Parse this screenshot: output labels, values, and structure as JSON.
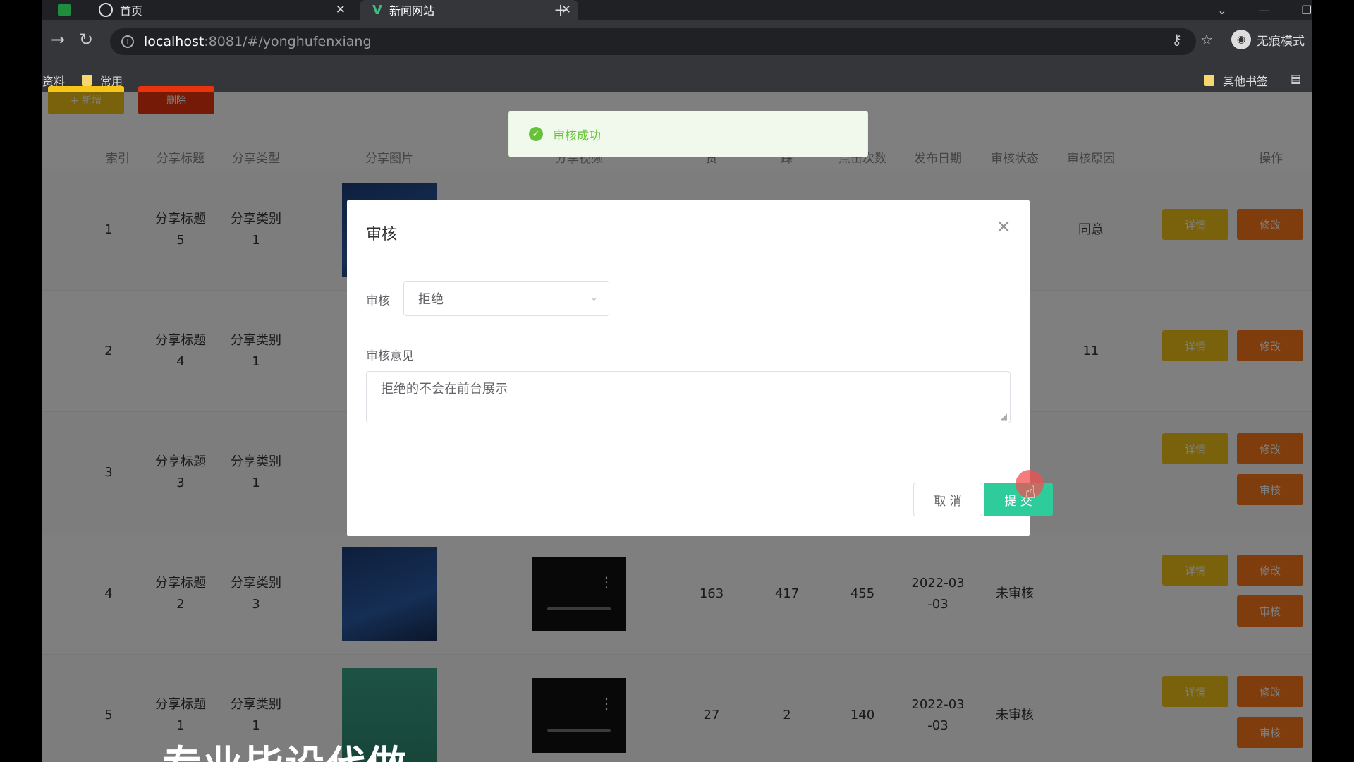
{
  "browser": {
    "tabs": [
      {
        "label": ""
      },
      {
        "label": "首页"
      },
      {
        "label": "新闻网站"
      }
    ],
    "url_host": "localhost",
    "url_path": ":8081/#/yonghufenxiang",
    "incognito_label": "无痕模式",
    "bookmarks_left": [
      "资料",
      "常用"
    ],
    "bookmarks_right": "其他书签"
  },
  "toolbar": {
    "add_label": "+ 新增",
    "delete_label": "删除"
  },
  "table": {
    "headers": [
      "索引",
      "分享标题",
      "分享类型",
      "分享图片",
      "分享视频",
      "赞",
      "踩",
      "点击次数",
      "发布日期",
      "审核状态",
      "审核原因",
      "操作"
    ],
    "rows": [
      {
        "index": "1",
        "title": "分享标题5",
        "type": "分享类别1",
        "likes": "",
        "dislikes": "",
        "clicks": "",
        "date": "",
        "status": "",
        "reason": "同意"
      },
      {
        "index": "2",
        "title": "分享标题4",
        "type": "分享类别1",
        "likes": "",
        "dislikes": "",
        "clicks": "",
        "date": "",
        "status": "",
        "reason": "11"
      },
      {
        "index": "3",
        "title": "分享标题3",
        "type": "分享类别1",
        "likes": "",
        "dislikes": "",
        "clicks": "",
        "date": "",
        "status": "",
        "reason": ""
      },
      {
        "index": "4",
        "title": "分享标题2",
        "type": "分享类别3",
        "likes": "163",
        "dislikes": "417",
        "clicks": "455",
        "date": "2022-03-03",
        "status": "未审核",
        "reason": ""
      },
      {
        "index": "5",
        "title": "分享标题1",
        "type": "分享类别1",
        "likes": "27",
        "dislikes": "2",
        "clicks": "140",
        "date": "2022-03-03",
        "status": "未审核",
        "reason": ""
      }
    ],
    "op_detail": "详情",
    "op_edit": "修改",
    "op_audit": "审核"
  },
  "toast": {
    "message": "审核成功"
  },
  "dialog": {
    "title": "审核",
    "audit_label": "审核",
    "audit_value": "拒绝",
    "opinion_label": "审核意见",
    "opinion_value": "拒绝的不会在前台展示",
    "cancel_label": "取 消",
    "submit_label": "提 交"
  },
  "watermark": "专业毕设代做",
  "colors": {
    "success": "#67c23a",
    "primary_button": "#2dcc9a",
    "detail_button": "#f5c518",
    "edit_button": "#ff7a1a"
  }
}
